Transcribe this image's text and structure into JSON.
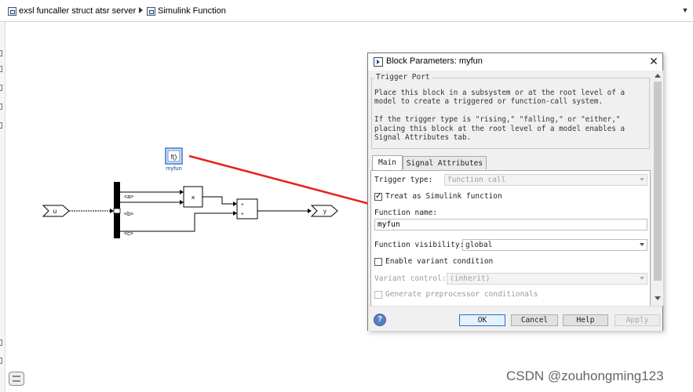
{
  "breadcrumb": {
    "items": [
      {
        "label": "exsl funcaller struct atsr server"
      },
      {
        "label": "Simulink Function"
      }
    ]
  },
  "diagram": {
    "trigger_block_text": "f()",
    "trigger_block_name": "myfun",
    "inport_label": "u",
    "outport_label": "y",
    "bus_labels": [
      "<a>",
      "<b>",
      "<c>"
    ],
    "product_sign": "×",
    "sum_signs": [
      "+",
      "+"
    ]
  },
  "dialog": {
    "title": "Block Parameters: myfun",
    "group_title": "Trigger Port",
    "description": "Place this block in a subsystem or at the root level of a model to create a triggered or function-call system.\n\nIf the trigger type is \"rising,\" \"falling,\" or \"either,\" placing this block at the root level of a model enables a Signal Attributes tab.",
    "tabs": [
      {
        "label": "Main"
      },
      {
        "label": "Signal Attributes"
      }
    ],
    "trigger_type": {
      "label": "Trigger type:",
      "value": "function call"
    },
    "treat_as_simulink": {
      "label": "Treat as Simulink function",
      "check": "✓"
    },
    "function_name": {
      "label": "Function name:",
      "value": "myfun"
    },
    "function_visibility": {
      "label": "Function visibility:",
      "value": "global"
    },
    "enable_variant": {
      "label": "Enable variant condition"
    },
    "variant_control": {
      "label": "Variant control:",
      "value": "(inherit)"
    },
    "generate_preprocessor": {
      "label": "Generate preprocessor conditionals"
    },
    "buttons": {
      "ok": "OK",
      "cancel": "Cancel",
      "help": "Help",
      "apply": "Apply"
    },
    "help_icon": "?"
  },
  "watermark": "CSDN @zouhongming123",
  "colors": {
    "arrow": "#e8211c",
    "accent": "#2a6ec6"
  }
}
